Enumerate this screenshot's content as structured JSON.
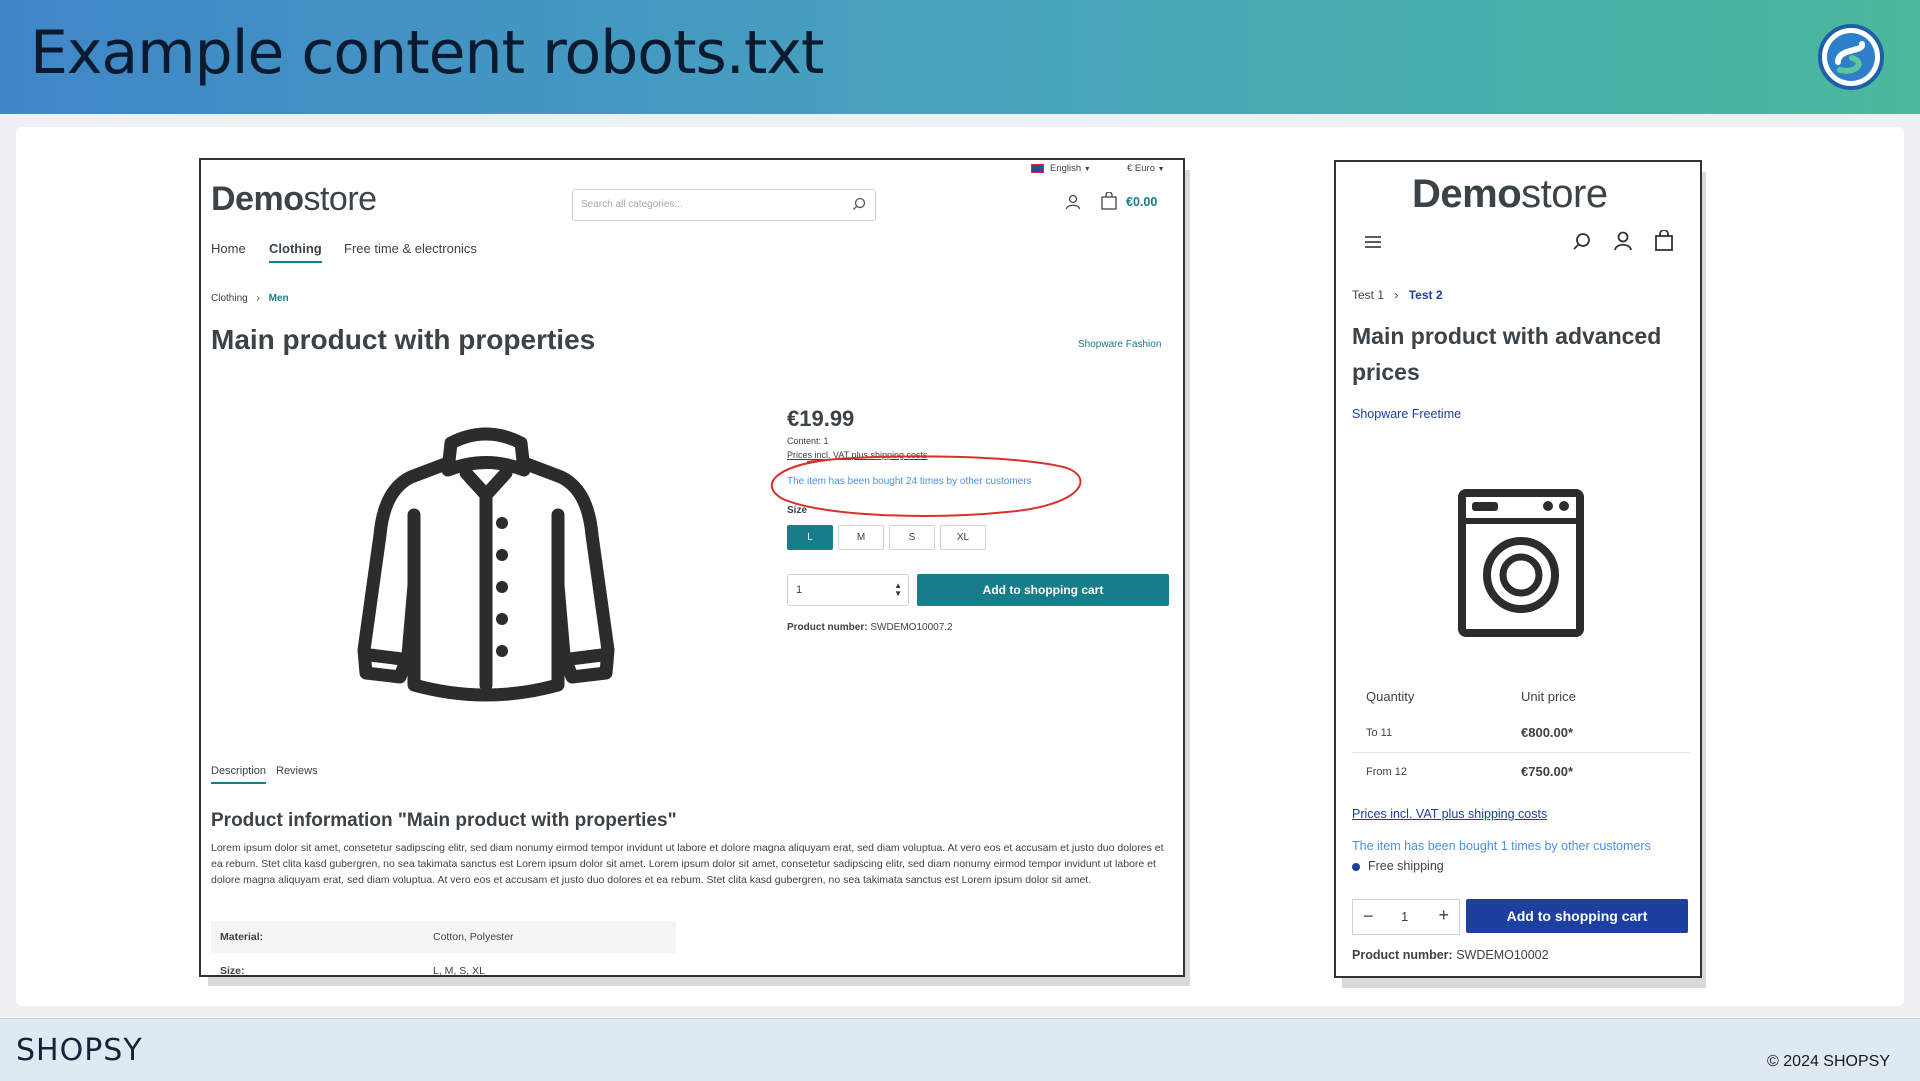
{
  "slide": {
    "title": "Example content robots.txt",
    "footer_logo": "SHOPSY",
    "copyright": "© 2024 SHOPSY"
  },
  "desktop": {
    "lang": "English",
    "currency": "€ Euro",
    "logo_bold": "Demo",
    "logo_light": "store",
    "search_placeholder": "Search all categories...",
    "cart_total": "€0.00",
    "nav": [
      "Home",
      "Clothing",
      "Free time & electronics"
    ],
    "breadcrumb": [
      "Clothing",
      "Men"
    ],
    "product_title": "Main product with properties",
    "manufacturer": "Shopware Fashion",
    "price": "€19.99",
    "content": "Content: 1",
    "vat": "Prices incl. VAT plus shipping costs",
    "bought_info": "The item has been bought 24 times by other customers",
    "size_label": "Size",
    "sizes": [
      "L",
      "M",
      "S",
      "XL"
    ],
    "qty": "1",
    "add_to_cart": "Add to shopping cart",
    "product_number_label": "Product number:",
    "product_number": "SWDEMO10007.2",
    "tabs": [
      "Description",
      "Reviews"
    ],
    "info_title": "Product information \"Main product with properties\"",
    "lorem": "Lorem ipsum dolor sit amet, consetetur sadipscing elitr, sed diam nonumy eirmod tempor invidunt ut labore et dolore magna aliquyam erat, sed diam voluptua. At vero eos et accusam et justo duo dolores et ea rebum. Stet clita kasd gubergren, no sea takimata sanctus est Lorem ipsum dolor sit amet. Lorem ipsum dolor sit amet, consetetur sadipscing elitr, sed diam nonumy eirmod tempor invidunt ut labore et dolore magna aliquyam erat, sed diam voluptua. At vero eos et accusam et justo duo dolores et ea rebum. Stet clita kasd gubergren, no sea takimata sanctus est Lorem ipsum dolor sit amet.",
    "spec_rows": [
      {
        "label": "Material:",
        "value": "Cotton, Polyester"
      },
      {
        "label": "Size:",
        "value": "L, M, S, XL"
      }
    ]
  },
  "mobile": {
    "logo_bold": "Demo",
    "logo_light": "store",
    "breadcrumb": [
      "Test 1",
      "Test 2"
    ],
    "product_title": "Main product with advanced prices",
    "manufacturer": "Shopware Freetime",
    "col_quantity": "Quantity",
    "col_unit_price": "Unit price",
    "price_rows": [
      {
        "qty": "To 11",
        "price": "€800.00*"
      },
      {
        "qty": "From 12",
        "price": "€750.00*"
      }
    ],
    "vat": "Prices incl. VAT plus shipping costs",
    "bought_info": "The item has been bought 1 times by other customers",
    "free_shipping": "Free shipping",
    "qty": "1",
    "add_to_cart": "Add to shopping cart",
    "product_number_label": "Product number:",
    "product_number": "SWDEMO10002"
  },
  "colors": {
    "teal": "#167d8a",
    "blue": "#1c3fa0",
    "annotation": "#d9302b"
  }
}
